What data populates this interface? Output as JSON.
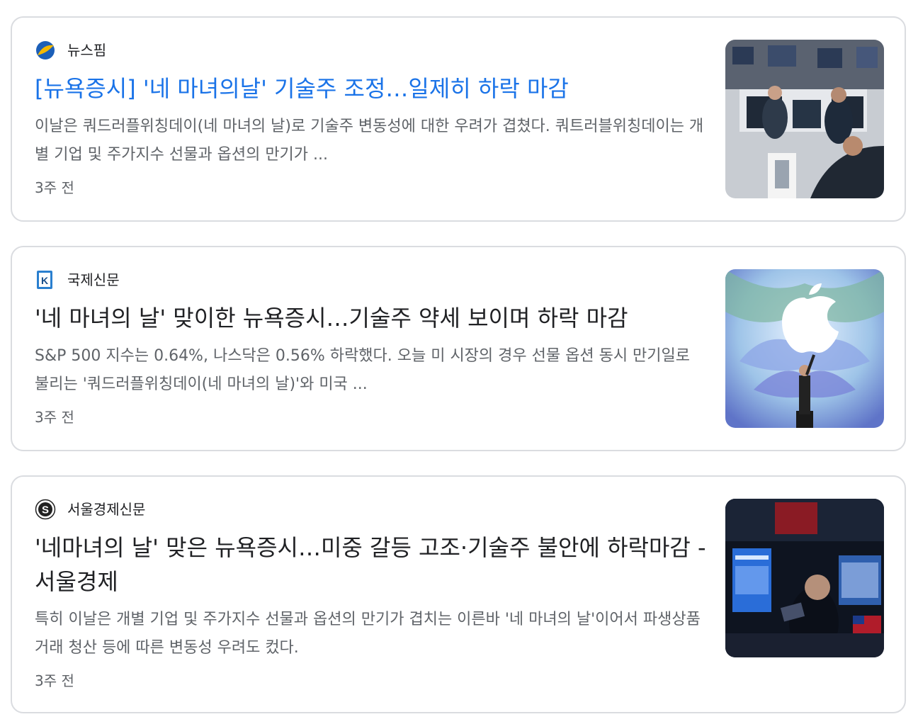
{
  "articles": [
    {
      "source": "뉴스핌",
      "headline": "[뉴욕증시] '네 마녀의날' 기술주 조정…일제히 하락 마감",
      "snippet": "이날은 쿼드러플위칭데이(네 마녀의 날)로 기술주 변동성에 대한 우려가 겹쳤다. 쿼트러블위칭데이는 개별 기업 및 주가지수 선물과 옵션의 만기가 ...",
      "time": "3주 전",
      "thumb_icon": "trading-floor-photo"
    },
    {
      "source": "국제신문",
      "headline": "'네 마녀의 날' 맞이한 뉴욕증시…기술주 약세 보이며 하락 마감",
      "snippet": "S&P 500 지수는 0.64%, 나스닥은 0.56% 하락했다. 오늘 미 시장의 경우 선물 옵션 동시 만기일로 불리는 '쿼드러플위칭데이(네 마녀의 날)'와 미국 ...",
      "time": "3주 전",
      "thumb_icon": "apple-event-photo"
    },
    {
      "source": "서울경제신문",
      "headline": "'네마녀의 날' 맞은 뉴욕증시…미중 갈등 고조·기술주 불안에 하락마감 - 서울경제",
      "snippet": "특히 이날은 개별 기업 및 주가지수 선물과 옵션의 만기가 겹치는 이른바 '네 마녀의 날'이어서 파생상품 거래 청산 등에 따른 변동성 우려도 컸다.",
      "time": "3주 전",
      "thumb_icon": "nyse-trader-photo"
    }
  ],
  "colors": {
    "visited_link": "#1a73e8",
    "headline": "#202124",
    "snippet": "#5f6368",
    "border": "#dadce0"
  }
}
